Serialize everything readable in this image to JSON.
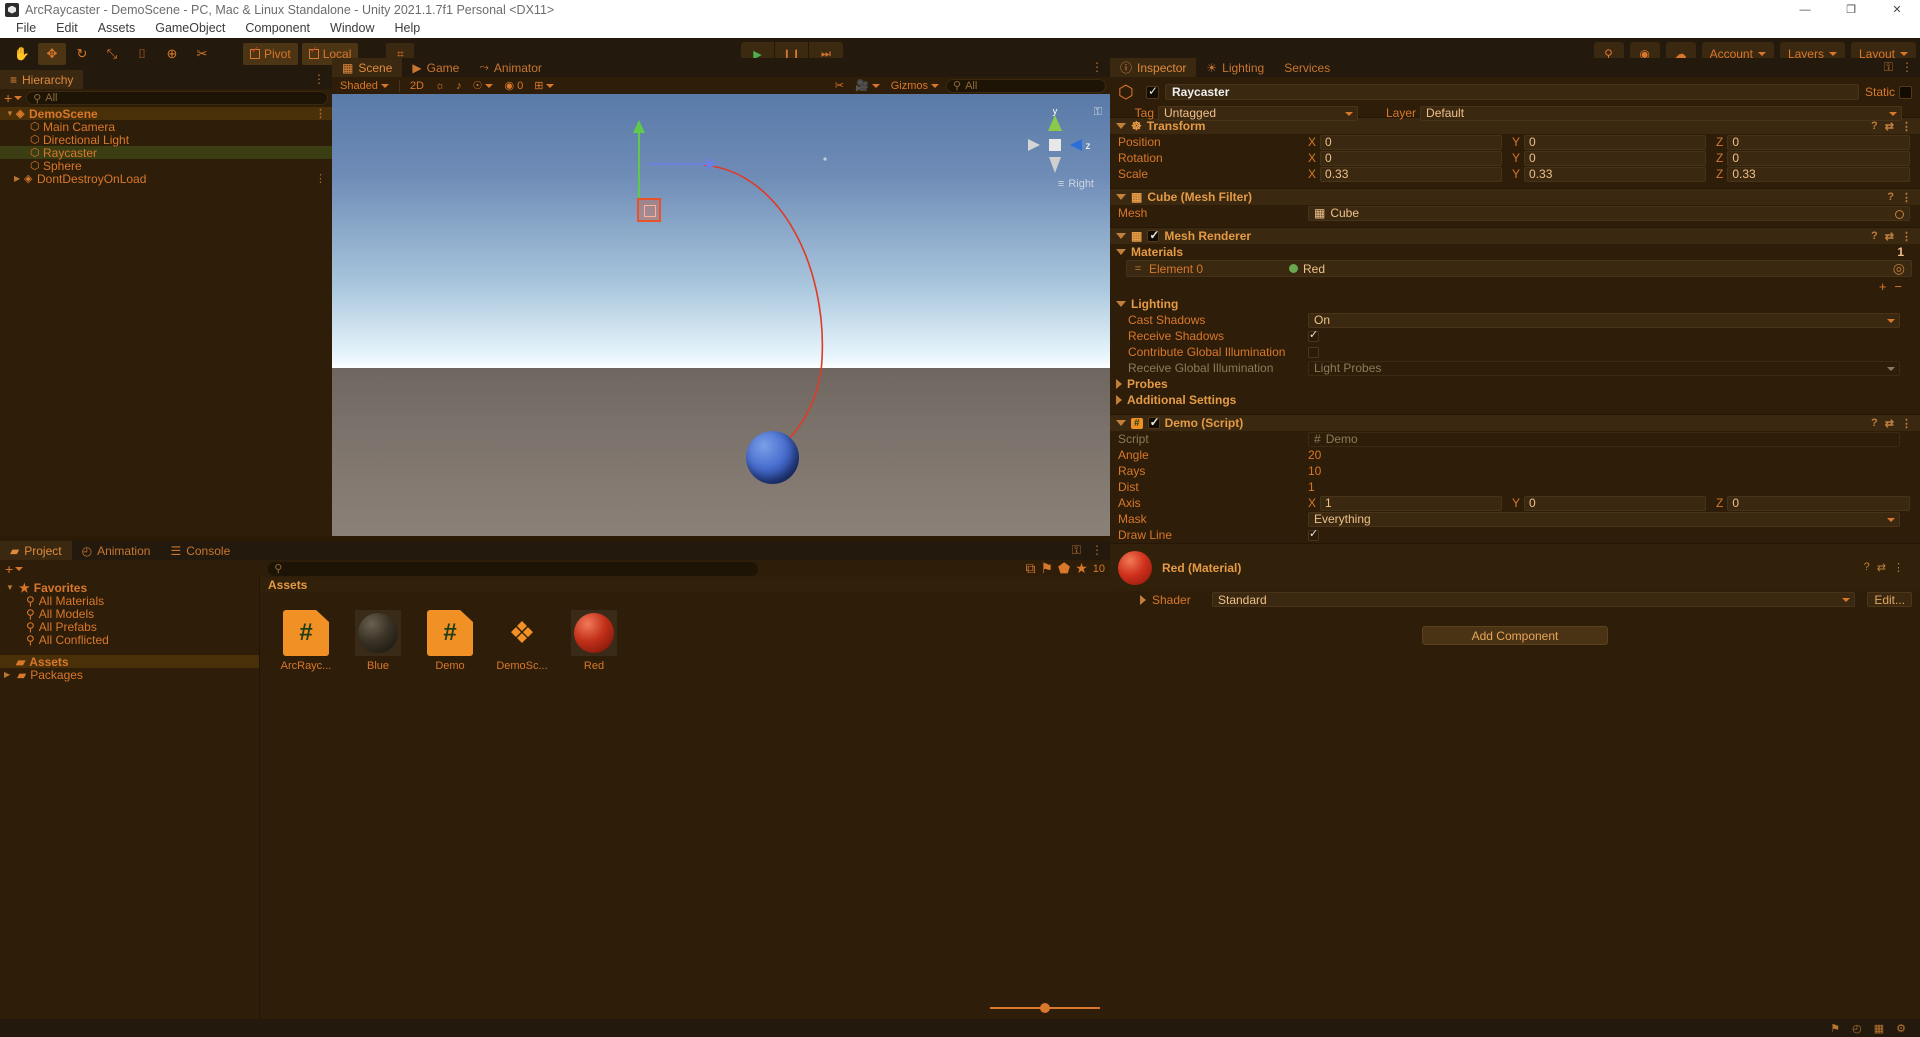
{
  "window": {
    "title": "ArcRaycaster - DemoScene - PC, Mac & Linux Standalone - Unity 2021.1.7f1 Personal <DX11>",
    "minimize": "—",
    "maximize": "❐",
    "close": "✕"
  },
  "menu": [
    "File",
    "Edit",
    "Assets",
    "GameObject",
    "Component",
    "Window",
    "Help"
  ],
  "toolbar": {
    "tools": [
      {
        "name": "hand-tool",
        "glyph": "✋",
        "active": false
      },
      {
        "name": "move-tool",
        "glyph": "✥",
        "active": true
      },
      {
        "name": "rotate-tool",
        "glyph": "↻",
        "active": false
      },
      {
        "name": "scale-tool",
        "glyph": "⤡",
        "active": false
      },
      {
        "name": "rect-tool",
        "glyph": "⌷",
        "active": false
      },
      {
        "name": "transform-tool",
        "glyph": "⊕",
        "active": false
      },
      {
        "name": "custom-tool",
        "glyph": "✂",
        "active": false
      }
    ],
    "pivot": "Pivot",
    "local": "Local",
    "snap_glyph": "⌗",
    "play": "▶",
    "pause": "❙❙",
    "step": "⏭",
    "search_glyph": "⚲",
    "cloud_glyph": "☁",
    "collab_glyph": "◉",
    "account": "Account",
    "layers": "Layers",
    "layout": "Layout"
  },
  "hierarchy": {
    "tab": "Hierarchy",
    "tab_icon": "≡",
    "add_label": "+",
    "search_placeholder": "All",
    "search_icon": "⚲",
    "items": [
      {
        "label": "DemoScene",
        "depth": 0,
        "icon": "scene",
        "expanded": true,
        "state": "scene-root",
        "dots": true
      },
      {
        "label": "Main Camera",
        "depth": 1,
        "icon": "gameobject",
        "state": "normal"
      },
      {
        "label": "Directional Light",
        "depth": 1,
        "icon": "gameobject",
        "state": "normal"
      },
      {
        "label": "Raycaster",
        "depth": 1,
        "icon": "gameobject",
        "state": "selected"
      },
      {
        "label": "Sphere",
        "depth": 1,
        "icon": "gameobject",
        "state": "normal"
      },
      {
        "label": "DontDestroyOnLoad",
        "depth": 0,
        "icon": "scene",
        "expanded": false,
        "state": "normal",
        "dots": true
      }
    ]
  },
  "scene": {
    "tabs": [
      {
        "label": "Scene",
        "icon": "▦",
        "active": true
      },
      {
        "label": "Game",
        "icon": "▶",
        "active": false
      },
      {
        "label": "Animator",
        "icon": "⤳",
        "active": false
      }
    ],
    "shading": "Shaded",
    "mode_2d": "2D",
    "light_icon": "☼",
    "audio_icon": "♪",
    "fx_icon": "☉",
    "vis_icon": "◉",
    "vis_count": "0",
    "grid_icon": "⊞",
    "gizmos": "Gizmos",
    "scene_search_placeholder": "All",
    "scene_search_icon": "⚲",
    "gizmo_axes": {
      "y": "y",
      "z": "z"
    },
    "view_label": "Right",
    "view_label_icon": "≡",
    "lock_icon": "⚿"
  },
  "project": {
    "tabs": [
      {
        "label": "Project",
        "icon": "▰",
        "active": true
      },
      {
        "label": "Animation",
        "icon": "◴",
        "active": false
      },
      {
        "label": "Console",
        "icon": "☰",
        "active": false
      }
    ],
    "add_label": "+",
    "search_placeholder": "",
    "search_icon": "⚲",
    "toolbar_icons": [
      "⧉",
      "⚑",
      "⬟",
      "★"
    ],
    "filter_count": "10",
    "tree": [
      {
        "label": "Favorites",
        "type": "favorites",
        "icon": "★",
        "depth": 0,
        "expanded": true
      },
      {
        "label": "All Materials",
        "type": "search",
        "icon": "⚲",
        "depth": 1
      },
      {
        "label": "All Models",
        "type": "search",
        "icon": "⚲",
        "depth": 1
      },
      {
        "label": "All Prefabs",
        "type": "search",
        "icon": "⚲",
        "depth": 1
      },
      {
        "label": "All Conflicted",
        "type": "search",
        "icon": "⚲",
        "depth": 1
      },
      {
        "label": "Assets",
        "type": "folder",
        "icon": "▰",
        "depth": 0,
        "selected": true
      },
      {
        "label": "Packages",
        "type": "folder",
        "icon": "▰",
        "depth": 0,
        "expanded": false
      }
    ],
    "breadcrumb": "Assets",
    "assets": [
      {
        "label": "ArcRayc...",
        "kind": "script",
        "glyph": "#"
      },
      {
        "label": "Blue",
        "kind": "material",
        "color": "#2a2414"
      },
      {
        "label": "Demo",
        "kind": "script",
        "glyph": "#"
      },
      {
        "label": "DemoSc...",
        "kind": "scene",
        "glyph": "❖"
      },
      {
        "label": "Red",
        "kind": "material",
        "color": "#b02a14"
      }
    ],
    "zoom_value": "45"
  },
  "inspector": {
    "tabs": [
      {
        "label": "Inspector",
        "icon": "ⓘ",
        "active": true
      },
      {
        "label": "Lighting",
        "icon": "☀",
        "active": false
      },
      {
        "label": "Services",
        "icon": "",
        "active": false
      }
    ],
    "lock_icon": "⚿",
    "menu_icon": "⋮",
    "object_name": "Raycaster",
    "enabled": true,
    "static_label": "Static",
    "tag_label": "Tag",
    "tag_value": "Untagged",
    "layer_label": "Layer",
    "layer_value": "Default",
    "components": [
      {
        "name": "Transform",
        "icon": "☸",
        "expanded": true,
        "has_checkbox": false,
        "rows": [
          {
            "label": "Position",
            "type": "vec3",
            "x": "0",
            "y": "0",
            "z": "0"
          },
          {
            "label": "Rotation",
            "type": "vec3",
            "x": "0",
            "y": "0",
            "z": "0"
          },
          {
            "label": "Scale",
            "type": "vec3",
            "x": "0.33",
            "y": "0.33",
            "z": "0.33"
          }
        ]
      },
      {
        "name": "Cube (Mesh Filter)",
        "icon": "▦",
        "expanded": true,
        "has_checkbox": false,
        "rows": [
          {
            "label": "Mesh",
            "type": "object",
            "value": "Cube",
            "value_icon": "▦"
          }
        ]
      },
      {
        "name": "Mesh Renderer",
        "icon": "▦",
        "expanded": true,
        "has_checkbox": true,
        "checked": true,
        "materials_label": "Materials",
        "materials_count": "1",
        "element_label": "Element 0",
        "element_value": "Red",
        "lighting_label": "Lighting",
        "rows": [
          {
            "label": "Cast Shadows",
            "type": "dropdown",
            "value": "On"
          },
          {
            "label": "Receive Shadows",
            "type": "checkbox",
            "checked": true
          },
          {
            "label": "Contribute Global Illumination",
            "type": "checkbox",
            "checked": false
          },
          {
            "label": "Receive Global Illumination",
            "type": "dropdown-dim",
            "value": "Light Probes",
            "dim": true
          }
        ],
        "folders": [
          {
            "label": "Probes",
            "expanded": false
          },
          {
            "label": "Additional Settings",
            "expanded": false
          }
        ]
      },
      {
        "name": "Demo (Script)",
        "icon": "#",
        "expanded": true,
        "has_checkbox": true,
        "checked": true,
        "rows": [
          {
            "label": "Script",
            "type": "object-dim",
            "value": "Demo",
            "value_icon": "#",
            "dim": true
          },
          {
            "label": "Angle",
            "type": "number",
            "value": "20"
          },
          {
            "label": "Rays",
            "type": "number",
            "value": "10"
          },
          {
            "label": "Dist",
            "type": "number",
            "value": "1"
          },
          {
            "label": "Axis",
            "type": "vec3",
            "x": "1",
            "y": "0",
            "z": "0"
          },
          {
            "label": "Mask",
            "type": "dropdown",
            "value": "Everything"
          },
          {
            "label": "Draw Line",
            "type": "checkbox",
            "checked": true
          }
        ]
      }
    ],
    "material_preview": {
      "title": "Red (Material)",
      "shader_label": "Shader",
      "shader_value": "Standard",
      "edit_label": "Edit..."
    },
    "add_component": "Add Component"
  },
  "statusbar": {
    "icons": [
      "⚑",
      "◴",
      "▦",
      "⚙"
    ]
  },
  "colors": {
    "accent": "#d9772b",
    "panel_bg": "#2e1e09",
    "header_bg": "#3a2810",
    "selection": "#3b3d12",
    "scene_root": "#4a3008",
    "play_green": "#4caf50",
    "red_material": "#b02a14",
    "arc_red": "#e03a26"
  }
}
